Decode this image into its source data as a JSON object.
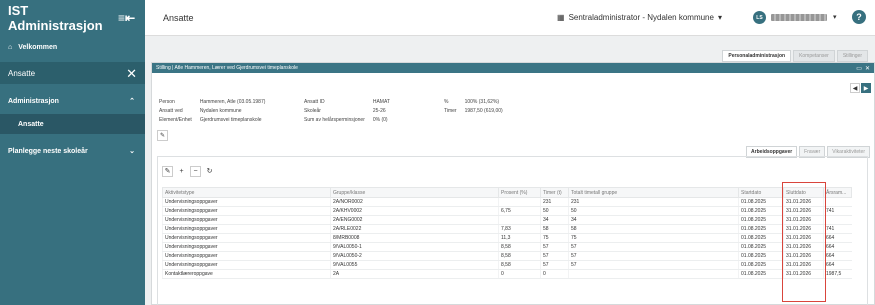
{
  "app": {
    "title": "IST Administrasjon"
  },
  "sidebar": {
    "home": "Velkommen",
    "active_item": "Ansatte",
    "sections": [
      {
        "label": "Administrasjon",
        "children": [
          "Ansatte"
        ]
      },
      {
        "label": "Planlegge neste skoleår"
      }
    ]
  },
  "header": {
    "page_title": "Ansatte",
    "org": "Sentraladministrator - Nydalen kommune",
    "avatar_initials": "LS",
    "help": "?"
  },
  "right_tabs": [
    "Personaladministrasjon",
    "Kompetanser",
    "Stillinger"
  ],
  "panel": {
    "title": "Stilling | Atle Hammeren, Lærer ved Gjerdrumsvei timeplanskole",
    "info_left": [
      [
        "Person",
        "Hammeren, Atle (03.05.1987)"
      ],
      [
        "Ansatt ved",
        "Nydalen kommune"
      ],
      [
        "Element/Enhet",
        "Gjerdrumsvei timeplanskole"
      ]
    ],
    "info_mid": [
      [
        "Ansatt ID",
        "HAMAT"
      ],
      [
        "Skoleår",
        "25-26"
      ],
      [
        "Sum av helårsperminsjoner",
        "0% (0)"
      ]
    ],
    "info_right": [
      [
        "%",
        "100% (31,62%)"
      ],
      [
        "Timer",
        "1987,50 (619,00)"
      ]
    ],
    "subtabs": [
      "Arbeidsoppgaver",
      "Fravær",
      "Vikaraktiviteter"
    ]
  },
  "table": {
    "headers": [
      "Aktivitetstype",
      "Gruppe/klasse",
      "Prosent (%)",
      "Timer (t)",
      "Totalt timetall gruppe",
      "Startdato",
      "Sluttdato",
      "Årsram..."
    ],
    "rows": [
      [
        "Undervisningsoppgaver",
        "2A/NOR0002",
        "",
        "231",
        "231",
        "01.08.2025",
        "31.01.2026",
        ""
      ],
      [
        "Undervisningsoppgaver",
        "2A/KHV0002",
        "6,75",
        "50",
        "50",
        "01.08.2025",
        "31.01.2026",
        "741"
      ],
      [
        "Undervisningsoppgaver",
        "2A/ENG0002",
        "",
        "34",
        "34",
        "01.08.2025",
        "31.01.2026",
        ""
      ],
      [
        "Undervisningsoppgaver",
        "2A/RLE0022",
        "7,83",
        "58",
        "58",
        "01.08.2025",
        "31.01.2026",
        "741"
      ],
      [
        "Undervisningsoppgaver",
        "8/MRB0008",
        "11,3",
        "75",
        "75",
        "01.08.2025",
        "31.01.2026",
        "664"
      ],
      [
        "Undervisningsoppgaver",
        "9/VAL0050-1",
        "8,58",
        "57",
        "57",
        "01.08.2025",
        "31.01.2026",
        "664"
      ],
      [
        "Undervisningsoppgaver",
        "9/VAL0050-2",
        "8,58",
        "57",
        "57",
        "01.08.2025",
        "31.01.2026",
        "664"
      ],
      [
        "Undervisningsoppgaver",
        "9/VAL0055",
        "8,58",
        "57",
        "57",
        "01.08.2025",
        "31.01.2026",
        "664"
      ],
      [
        "Kontaktlæreroppgave",
        "2A",
        "0",
        "0",
        "",
        "01.08.2025",
        "31.01.2026",
        "1987,5"
      ]
    ]
  },
  "colors": {
    "sidebar": "#37707f",
    "panel_header": "#3b7585",
    "highlight": "#d9453c"
  }
}
